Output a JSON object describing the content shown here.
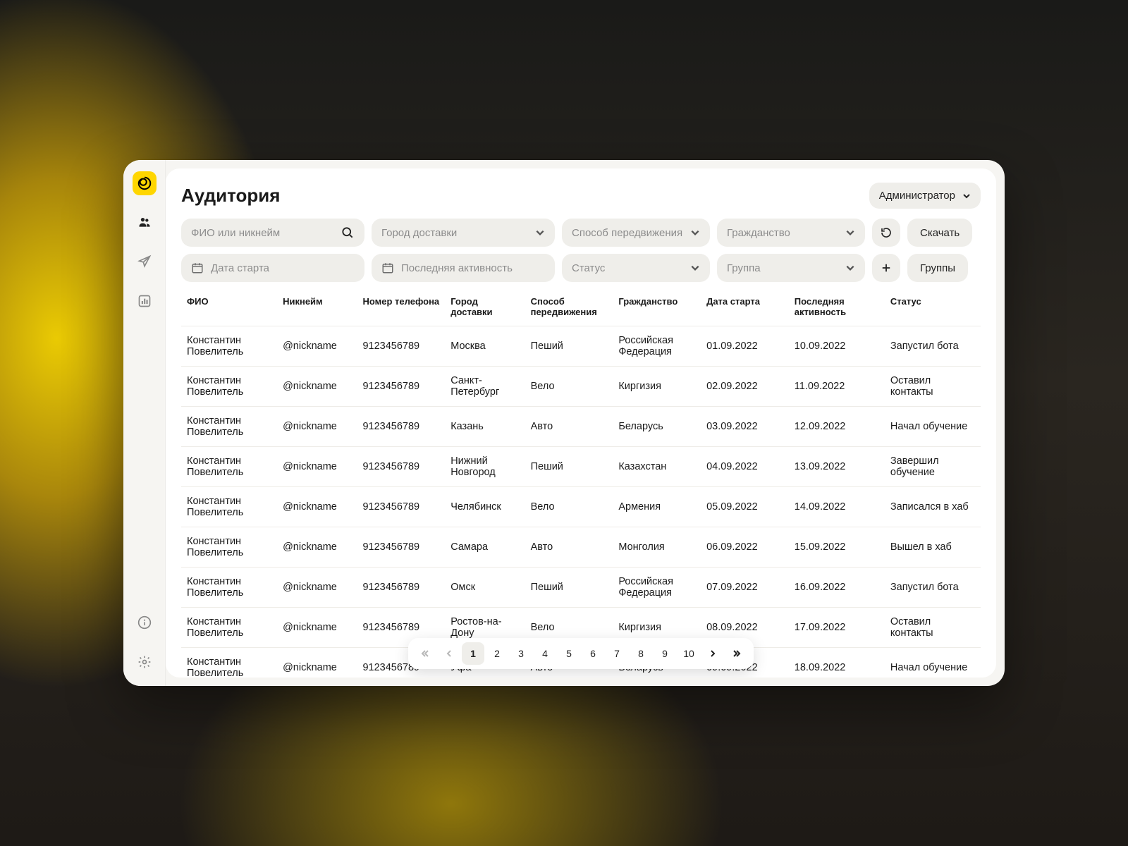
{
  "header": {
    "title": "Аудитория",
    "admin_label": "Администратор"
  },
  "filters": {
    "search_placeholder": "ФИО или никнейм",
    "city": "Город доставки",
    "movement": "Способ передвижения",
    "citizenship": "Гражданство",
    "start_date": "Дата старта",
    "last_activity": "Последняя активность",
    "status": "Статус",
    "group": "Группа"
  },
  "buttons": {
    "download": "Скачать",
    "groups": "Группы"
  },
  "table": {
    "headers": {
      "fio": "ФИО",
      "nickname": "Никнейм",
      "phone": "Номер телефона",
      "city": "Город доставки",
      "movement": "Способ передвижения",
      "citizenship": "Гражданство",
      "start": "Дата старта",
      "last": "Последняя активность",
      "status": "Статус"
    },
    "rows": [
      {
        "fio": "Константин Повелитель",
        "nick": "@nickname",
        "phone": "9123456789",
        "city": "Москва",
        "move": "Пеший",
        "cit": "Российская Федерация",
        "start": "01.09.2022",
        "last": "10.09.2022",
        "status": "Запустил бота"
      },
      {
        "fio": "Константин Повелитель",
        "nick": "@nickname",
        "phone": "9123456789",
        "city": "Санкт-Петербург",
        "move": "Вело",
        "cit": "Киргизия",
        "start": "02.09.2022",
        "last": "11.09.2022",
        "status": "Оставил контакты"
      },
      {
        "fio": "Константин Повелитель",
        "nick": "@nickname",
        "phone": "9123456789",
        "city": "Казань",
        "move": "Авто",
        "cit": "Беларусь",
        "start": "03.09.2022",
        "last": "12.09.2022",
        "status": "Начал обучение"
      },
      {
        "fio": "Константин Повелитель",
        "nick": "@nickname",
        "phone": "9123456789",
        "city": "Нижний Новгород",
        "move": "Пеший",
        "cit": "Казахстан",
        "start": "04.09.2022",
        "last": "13.09.2022",
        "status": "Завершил обучение"
      },
      {
        "fio": "Константин Повелитель",
        "nick": "@nickname",
        "phone": "9123456789",
        "city": "Челябинск",
        "move": "Вело",
        "cit": "Армения",
        "start": "05.09.2022",
        "last": "14.09.2022",
        "status": "Записался в хаб"
      },
      {
        "fio": "Константин Повелитель",
        "nick": "@nickname",
        "phone": "9123456789",
        "city": "Самара",
        "move": "Авто",
        "cit": "Монголия",
        "start": "06.09.2022",
        "last": "15.09.2022",
        "status": "Вышел в хаб"
      },
      {
        "fio": "Константин Повелитель",
        "nick": "@nickname",
        "phone": "9123456789",
        "city": "Омск",
        "move": "Пеший",
        "cit": "Российская Федерация",
        "start": "07.09.2022",
        "last": "16.09.2022",
        "status": "Запустил бота"
      },
      {
        "fio": "Константин Повелитель",
        "nick": "@nickname",
        "phone": "9123456789",
        "city": "Ростов-на-Дону",
        "move": "Вело",
        "cit": "Киргизия",
        "start": "08.09.2022",
        "last": "17.09.2022",
        "status": "Оставил контакты"
      },
      {
        "fio": "Константин Повелитель",
        "nick": "@nickname",
        "phone": "9123456789",
        "city": "Уфа",
        "move": "Авто",
        "cit": "Беларусь",
        "start": "09.09.2022",
        "last": "18.09.2022",
        "status": "Начал обучение"
      }
    ]
  },
  "pagination": {
    "pages": [
      "1",
      "2",
      "3",
      "4",
      "5",
      "6",
      "7",
      "8",
      "9",
      "10"
    ],
    "current": 1
  }
}
